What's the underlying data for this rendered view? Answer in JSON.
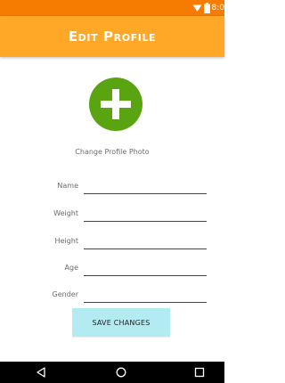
{
  "status_bar": {
    "time": "8:0",
    "icons": [
      "wifi-icon",
      "battery-icon"
    ]
  },
  "app_bar": {
    "title": "Edit Profile"
  },
  "profile_photo": {
    "icon": "plus-icon",
    "color": "#5aa412",
    "label": "Change Profile Photo"
  },
  "form": {
    "fields": [
      {
        "label": "Name",
        "value": ""
      },
      {
        "label": "Weight",
        "value": ""
      },
      {
        "label": "Height",
        "value": ""
      },
      {
        "label": "Age",
        "value": ""
      },
      {
        "label": "Gender",
        "value": ""
      }
    ]
  },
  "save_button": {
    "label": "SAVE CHANGES",
    "color": "#b2ebf2"
  },
  "nav_bar": {
    "buttons": [
      "back-icon",
      "home-icon",
      "recents-icon"
    ]
  },
  "theme": {
    "status_bar_color": "#f57c00",
    "app_bar_color": "#ffa726"
  }
}
